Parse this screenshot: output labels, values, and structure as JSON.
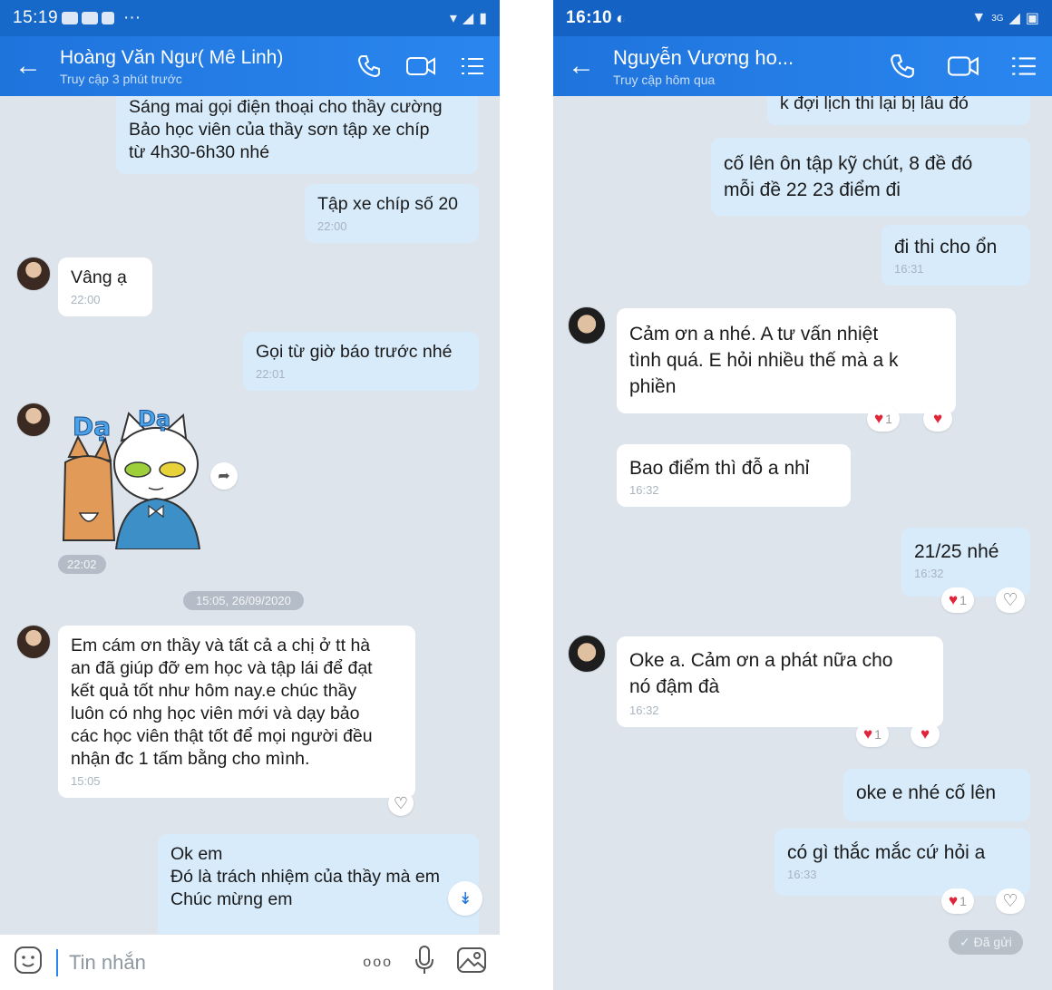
{
  "left": {
    "status": {
      "time": "15:19",
      "notif_icons": "■■■",
      "more": "···"
    },
    "header": {
      "name": "Hoàng Văn Ngư( Mê Linh)",
      "subtitle": "Truy cập 3 phút trước"
    },
    "messages": {
      "m1": {
        "text": "Sáng mai gọi điện thoại cho thầy cường\nBảo học viên của thầy sơn tập xe chíp\ntừ 4h30-6h30 nhé"
      },
      "m2": {
        "text": "Tập xe chíp số 20",
        "time": "22:00"
      },
      "m3": {
        "text": "Vâng ạ",
        "time": "22:00"
      },
      "m4": {
        "text": "Gọi từ giờ báo trước nhé",
        "time": "22:01"
      },
      "sticker": {
        "label1": "Dạ",
        "label2": "Dạ",
        "time": "22:02"
      },
      "date_sep": "15:05, 26/09/2020",
      "m5": {
        "text": "Em cám ơn thầy và tất cả a chị ở tt hà\nan đã giúp đỡ em học và tập lái để đạt\nkết quả tốt như hôm nay.e chúc thầy\nluôn có nhg học viên mới và dạy bảo\ncác học viên thật tốt để mọi người đều\nnhận đc 1 tấm bằng cho mình.",
        "time": "15:05"
      },
      "m6": {
        "text": "Ok em\nĐó là trách nhiệm của thầy mà em\nChúc mừng em"
      }
    },
    "input": {
      "placeholder": "Tin nhắn",
      "more": "ooo"
    }
  },
  "right": {
    "status": {
      "time": "16:10",
      "network": "3G"
    },
    "header": {
      "name": "Nguyễn Vương ho...",
      "subtitle": "Truy cập hôm qua"
    },
    "messages": {
      "r0": {
        "text": "k đợi lịch thi lại bị lâu đó"
      },
      "r1": {
        "text": "cố lên ôn tập kỹ chút, 8 đề đó\nmỗi đề 22 23 điểm đi"
      },
      "r2": {
        "text": "đi thi cho ổn",
        "time": "16:31"
      },
      "r3": {
        "text": "Cảm ơn a nhé. A tư vấn nhiệt\ntình quá. E hỏi nhiều thế mà a k\nphiền",
        "react_count": "1"
      },
      "r4": {
        "text": "Bao điểm thì đỗ a nhỉ",
        "time": "16:32"
      },
      "r5": {
        "text": "21/25 nhé",
        "time": "16:32",
        "react_count": "1"
      },
      "r6": {
        "text": "Oke a. Cảm ơn a phát nữa cho\nnó đậm đà",
        "time": "16:32",
        "react_count": "1"
      },
      "r7": {
        "text": "oke e nhé cố lên"
      },
      "r8": {
        "text": "có gì thắc mắc cứ hỏi a",
        "time": "16:33",
        "react_count": "1"
      },
      "sent": "Đã gửi"
    }
  },
  "colors": {
    "header": "#2a86ef",
    "statusbar": "#1669c9",
    "out_bubble": "#d7ebfb",
    "in_bubble": "#ffffff",
    "chat_bg": "#dde4ec",
    "heart": "#e0243a"
  },
  "icons": [
    "back-arrow-icon",
    "phone-icon",
    "video-icon",
    "menu-list-icon",
    "share-icon",
    "scroll-down-icon",
    "emoji-icon",
    "mic-icon",
    "image-icon",
    "heart-icon",
    "heart-outline-icon",
    "check-icon"
  ]
}
